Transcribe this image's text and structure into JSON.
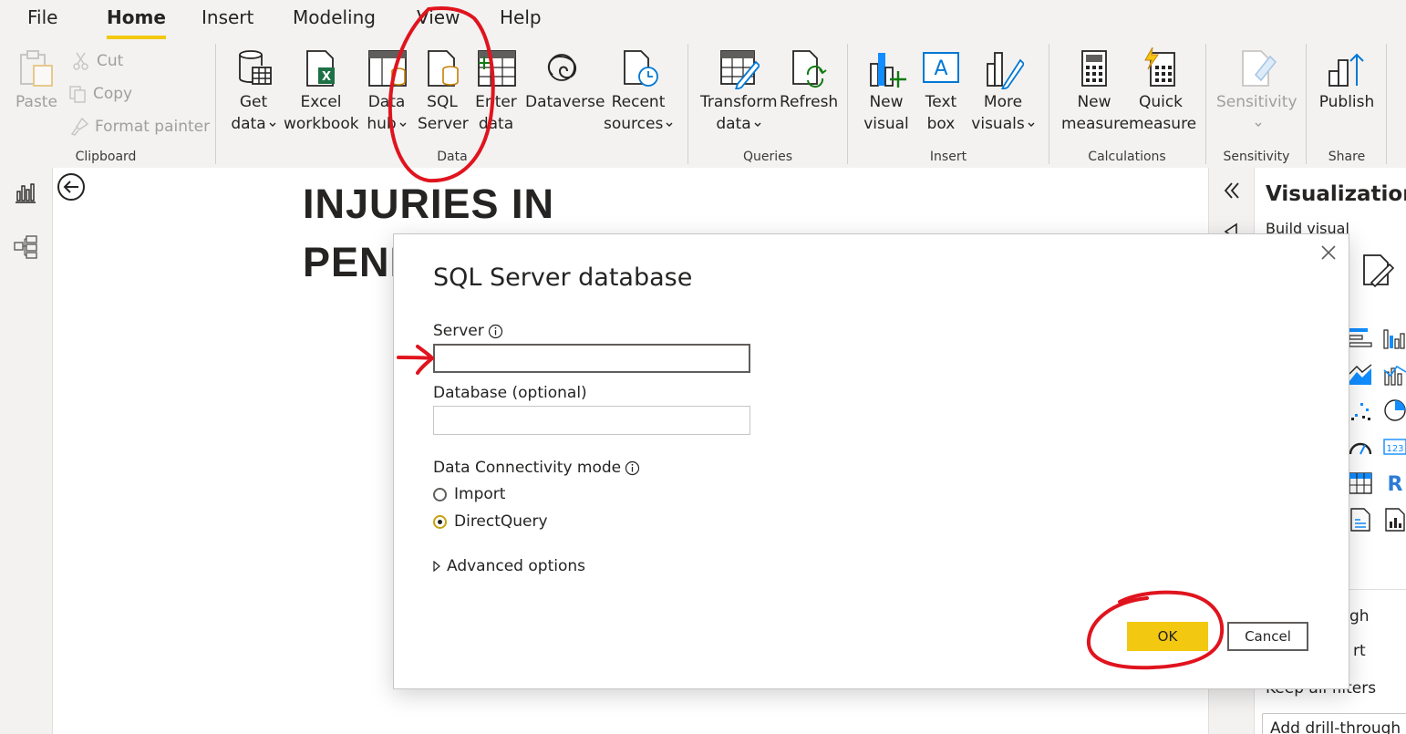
{
  "tabs": [
    "File",
    "Home",
    "Insert",
    "Modeling",
    "View",
    "Help"
  ],
  "ribbon": {
    "clipboard": {
      "paste": "Paste",
      "cut": "Cut",
      "copy": "Copy",
      "format_painter": "Format painter",
      "group": "Clipboard"
    },
    "data": {
      "get_data": [
        "Get",
        "data"
      ],
      "excel": [
        "Excel",
        "workbook"
      ],
      "data_hub": [
        "Data",
        "hub"
      ],
      "sql_server": [
        "SQL",
        "Server"
      ],
      "enter_data": [
        "Enter",
        "data"
      ],
      "dataverse": "Dataverse",
      "recent_sources": [
        "Recent",
        "sources"
      ],
      "group": "Data"
    },
    "queries": {
      "transform": [
        "Transform",
        "data"
      ],
      "refresh": "Refresh",
      "group": "Queries"
    },
    "insert": {
      "new_visual": [
        "New",
        "visual"
      ],
      "text_box": [
        "Text",
        "box"
      ],
      "more_visuals": [
        "More",
        "visuals"
      ],
      "group": "Insert"
    },
    "calculations": {
      "new_measure": [
        "New",
        "measure"
      ],
      "quick_measure": [
        "Quick",
        "measure"
      ],
      "group": "Calculations"
    },
    "sensitivity": {
      "label": "Sensitivity",
      "group": "Sensitivity"
    },
    "share": {
      "publish": "Publish",
      "group": "Share"
    }
  },
  "canvas": {
    "title_line1": "INJURIES IN",
    "title_line2": "PENN"
  },
  "viz_pane": {
    "title": "Visualizations",
    "subtitle": "Build visual",
    "drill_text_1": "gh",
    "drill_text_2": "rt",
    "keep_filters": "Keep all filters",
    "add_drill": "Add drill-through f"
  },
  "dialog": {
    "title": "SQL Server database",
    "server_label": "Server",
    "server_value": "",
    "database_label": "Database (optional)",
    "database_value": "",
    "mode_label": "Data Connectivity mode",
    "mode_options": [
      "Import",
      "DirectQuery"
    ],
    "mode_selected": "DirectQuery",
    "advanced": "Advanced options",
    "ok": "OK",
    "cancel": "Cancel"
  },
  "colors": {
    "accent": "#f2c811",
    "annotation": "#e0141e",
    "ribbon_bg": "#f3f2f1"
  }
}
